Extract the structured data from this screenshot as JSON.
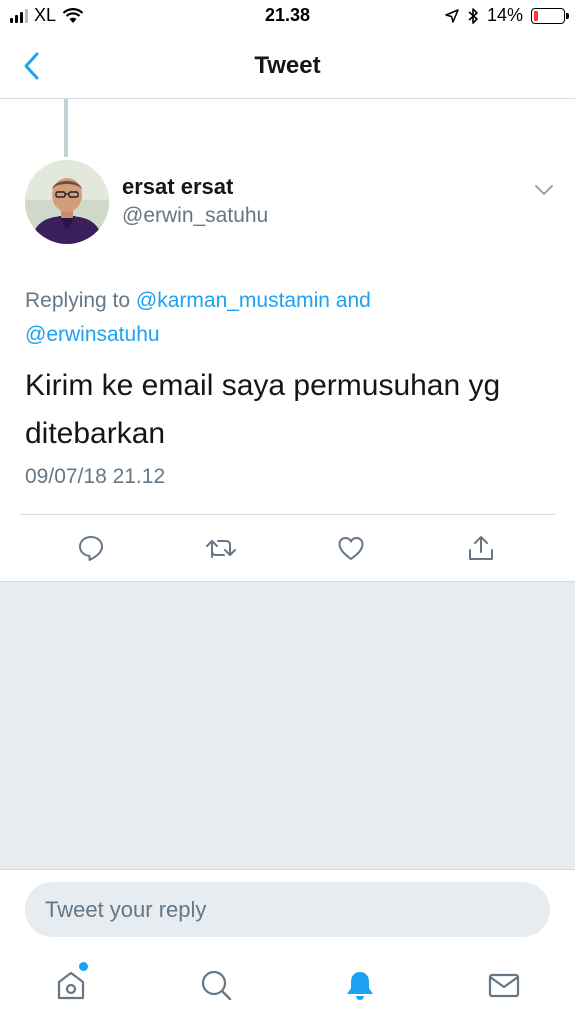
{
  "status_bar": {
    "carrier": "XL",
    "time": "21.38",
    "battery_percent": "14%",
    "battery_level": 0.14,
    "icons": [
      "signal-icon",
      "wifi-icon",
      "location-icon",
      "bluetooth-icon",
      "battery-icon"
    ]
  },
  "nav": {
    "title": "Tweet",
    "back_icon": "chevron-left-icon"
  },
  "tweet": {
    "author_name": "ersat ersat",
    "author_handle": "@erwin_satuhu",
    "replying_prefix": "Replying to",
    "mention_1": "@karman_mustamin",
    "mention_joiner": "and",
    "mention_2": "@erwinsatuhu",
    "text": "Kirim ke email saya permusuhan yg ditebarkan",
    "timestamp": "09/07/18 21.12",
    "actions": [
      "reply-icon",
      "retweet-icon",
      "like-icon",
      "share-icon"
    ]
  },
  "composer": {
    "placeholder": "Tweet your reply",
    "value": ""
  },
  "tab_bar": {
    "items": [
      "home-icon",
      "search-icon",
      "notifications-icon",
      "messages-icon"
    ],
    "active": "notifications-icon"
  },
  "colors": {
    "accent": "#1da1f2",
    "secondary_text": "#657786",
    "background_gray": "#e6ecf0",
    "battery_low": "#ff3b30"
  }
}
